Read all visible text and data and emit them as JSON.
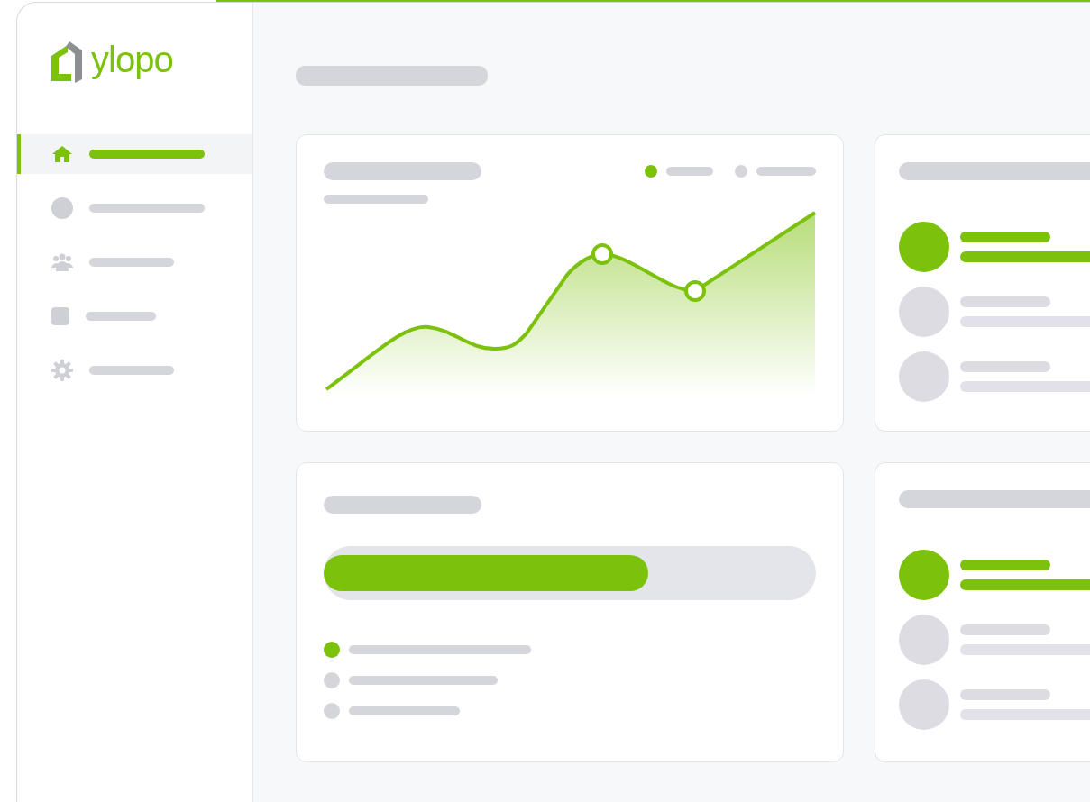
{
  "logo": {
    "text": "ylopo"
  },
  "nav": [
    {
      "kind": "home",
      "selected": true
    },
    {
      "kind": "circle",
      "selected": false
    },
    {
      "kind": "people",
      "selected": false
    },
    {
      "kind": "square",
      "selected": false
    },
    {
      "kind": "gear",
      "selected": false
    }
  ],
  "chart_card": {
    "legend": [
      {
        "color": "#7cc10c"
      },
      {
        "color": "#d5d6db"
      }
    ]
  },
  "list_cards": [
    {
      "items": [
        {
          "selected": true
        },
        {
          "selected": false
        },
        {
          "selected": false
        }
      ]
    },
    {
      "items": [
        {
          "selected": true
        },
        {
          "selected": false
        },
        {
          "selected": false
        }
      ]
    }
  ],
  "progress_card": {
    "level": 0.66,
    "items": [
      {
        "color": "#7cc10c"
      },
      {
        "color": "#d5d6db"
      },
      {
        "color": "#d5d6db"
      }
    ]
  }
}
